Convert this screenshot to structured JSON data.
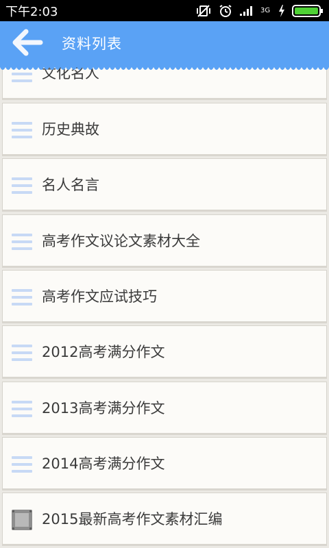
{
  "status_bar": {
    "time": "下午2:03",
    "network": "3G"
  },
  "header": {
    "title": "资料列表",
    "back_icon": "arrow-left-icon"
  },
  "colors": {
    "appbar": "#5aa2f5",
    "item_background": "#fcfbf8",
    "menu_icon": "#c7d9f5",
    "text": "#3a3a3a"
  },
  "list": {
    "items": [
      {
        "label": "文化名人",
        "icon": "menu-lines-icon"
      },
      {
        "label": "历史典故",
        "icon": "menu-lines-icon"
      },
      {
        "label": "名人名言",
        "icon": "menu-lines-icon"
      },
      {
        "label": "高考作文议论文素材大全",
        "icon": "menu-lines-icon"
      },
      {
        "label": "高考作文应试技巧",
        "icon": "menu-lines-icon"
      },
      {
        "label": "2012高考满分作文",
        "icon": "menu-lines-icon"
      },
      {
        "label": "2013高考满分作文",
        "icon": "menu-lines-icon"
      },
      {
        "label": "2014高考满分作文",
        "icon": "menu-lines-icon"
      },
      {
        "label": "2015最新高考作文素材汇编",
        "icon": "gray-square-icon"
      }
    ]
  }
}
